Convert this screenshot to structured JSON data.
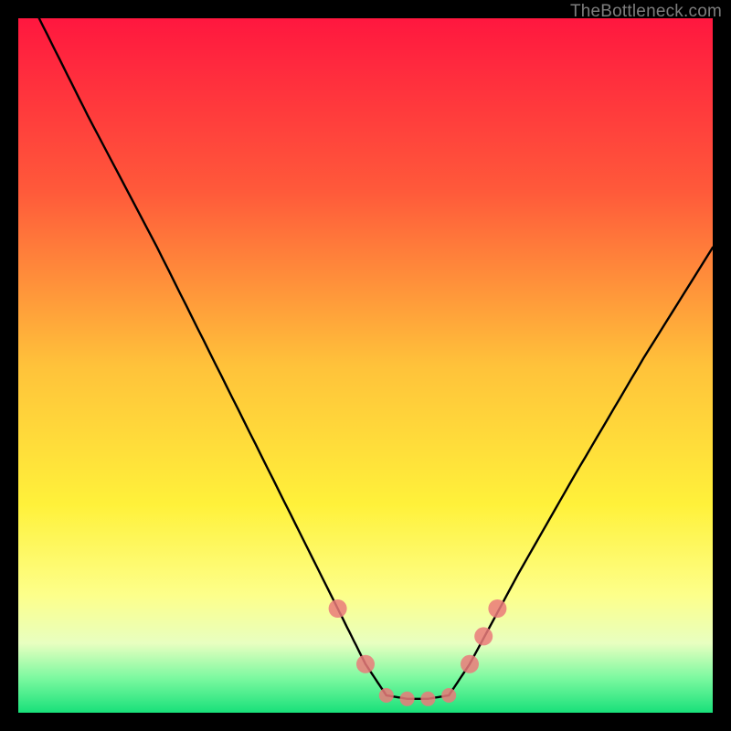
{
  "attribution": "TheBottleneck.com",
  "colors": {
    "frame_bg": "#000000",
    "curve": "#000000",
    "marker_fill": "#ea7a7a",
    "marker_stroke": "#c85a5a",
    "gradient_top": "#ff173f",
    "gradient_bottom": "#18e07a"
  },
  "chart_data": {
    "type": "line",
    "title": "",
    "xlabel": "",
    "ylabel": "",
    "xlim": [
      0,
      100
    ],
    "ylim": [
      0,
      100
    ],
    "grid": false,
    "legend": false,
    "series": [
      {
        "name": "bottleneck-curve",
        "x": [
          3,
          10,
          20,
          30,
          40,
          46,
          50,
          53,
          56,
          59,
          62,
          65,
          72,
          80,
          90,
          100
        ],
        "y": [
          100,
          86,
          67,
          47,
          27,
          15,
          7,
          2.5,
          2,
          2,
          2.5,
          7,
          20,
          34,
          51,
          67
        ]
      }
    ],
    "markers": [
      {
        "name": "left-upper",
        "x": 46,
        "y": 15,
        "r": 10
      },
      {
        "name": "left-lower",
        "x": 50,
        "y": 7,
        "r": 10
      },
      {
        "name": "flat-1",
        "x": 53,
        "y": 2.5,
        "r": 8
      },
      {
        "name": "flat-2",
        "x": 56,
        "y": 2,
        "r": 8
      },
      {
        "name": "flat-3",
        "x": 59,
        "y": 2,
        "r": 8
      },
      {
        "name": "flat-4",
        "x": 62,
        "y": 2.5,
        "r": 8
      },
      {
        "name": "right-lower",
        "x": 65,
        "y": 7,
        "r": 10
      },
      {
        "name": "right-mid",
        "x": 67,
        "y": 11,
        "r": 10
      },
      {
        "name": "right-upper",
        "x": 69,
        "y": 15,
        "r": 10
      }
    ]
  }
}
